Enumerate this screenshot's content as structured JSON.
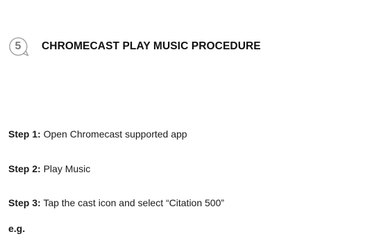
{
  "section": {
    "number": "5",
    "title": "CHROMECAST PLAY MUSIC PROCEDURE"
  },
  "steps": [
    {
      "label": "Step 1:",
      "text": "Open Chromecast supported app"
    },
    {
      "label": "Step 2:",
      "text": "Play Music"
    },
    {
      "label": "Step 3:",
      "text": "Tap the cast icon and select “Citation 500”"
    }
  ],
  "example_label": "e.g.",
  "colors": {
    "badge_outline": "#9a9a9a",
    "badge_text": "#7a7a7a",
    "text": "#1a1a1a"
  },
  "icons": {
    "badge": "speech-bubble-number-icon"
  }
}
